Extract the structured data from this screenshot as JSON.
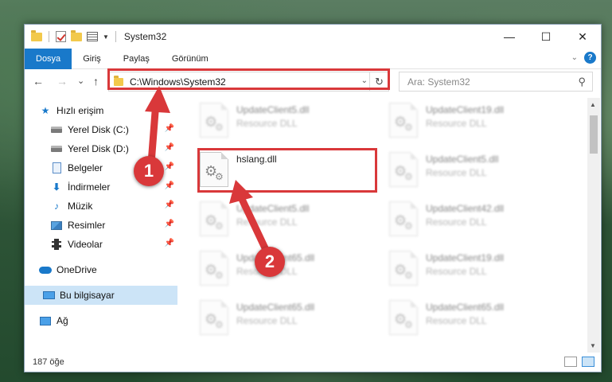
{
  "window": {
    "title": "System32",
    "minimize_glyph": "—",
    "maximize_glyph": "☐",
    "close_glyph": "✕"
  },
  "ribbon": {
    "tabs": [
      "Dosya",
      "Giriş",
      "Paylaş",
      "Görünüm"
    ],
    "help_label": "?"
  },
  "nav": {
    "back_glyph": "←",
    "forward_glyph": "→",
    "recent_glyph": "⌄",
    "up_glyph": "↑",
    "address": "C:\\Windows\\System32",
    "address_dropdown_glyph": "⌄",
    "refresh_glyph": "↻",
    "search_placeholder": "Ara: System32",
    "search_icon_glyph": "⚲"
  },
  "sidebar": {
    "items": [
      {
        "label": "Hızlı erişim",
        "icon": "star-icon",
        "pinned": false
      },
      {
        "label": "Yerel Disk (C:)",
        "icon": "drive-icon",
        "pinned": true
      },
      {
        "label": "Yerel Disk (D:)",
        "icon": "drive-icon",
        "pinned": true
      },
      {
        "label": "Belgeler",
        "icon": "documents-icon",
        "pinned": true
      },
      {
        "label": "İndirmeler",
        "icon": "download-icon",
        "pinned": true
      },
      {
        "label": "Müzik",
        "icon": "music-icon",
        "pinned": true
      },
      {
        "label": "Resimler",
        "icon": "pictures-icon",
        "pinned": true
      },
      {
        "label": "Videolar",
        "icon": "videos-icon",
        "pinned": true
      },
      {
        "label": "OneDrive",
        "icon": "cloud-icon",
        "pinned": false
      },
      {
        "label": "Bu bilgisayar",
        "icon": "computer-icon",
        "pinned": false,
        "selected": true
      },
      {
        "label": "Ağ",
        "icon": "network-icon",
        "pinned": false
      }
    ]
  },
  "files": {
    "left_column": [
      {
        "name": "UpdateClient5.dll",
        "type": "Resource DLL"
      },
      {
        "name": "hslang.dll",
        "type": ""
      },
      {
        "name": "UpdateClient5.dll",
        "type": "Resource DLL"
      },
      {
        "name": "UpdateClient65.dll",
        "type": "Resource DLL"
      },
      {
        "name": "UpdateClient65.dll",
        "type": "Resource DLL"
      }
    ],
    "right_column": [
      {
        "name": "UpdateClient19.dll",
        "type": "Resource DLL"
      },
      {
        "name": "UpdateClient5.dll",
        "type": "Resource DLL"
      },
      {
        "name": "UpdateClient42.dll",
        "type": "Resource DLL"
      },
      {
        "name": "UpdateClient19.dll",
        "type": "Resource DLL"
      },
      {
        "name": "UpdateClient65.dll",
        "type": "Resource DLL"
      }
    ]
  },
  "status": {
    "item_count": "187 öğe"
  },
  "annotations": {
    "step1": "1",
    "step2": "2",
    "color": "#d9383a"
  }
}
